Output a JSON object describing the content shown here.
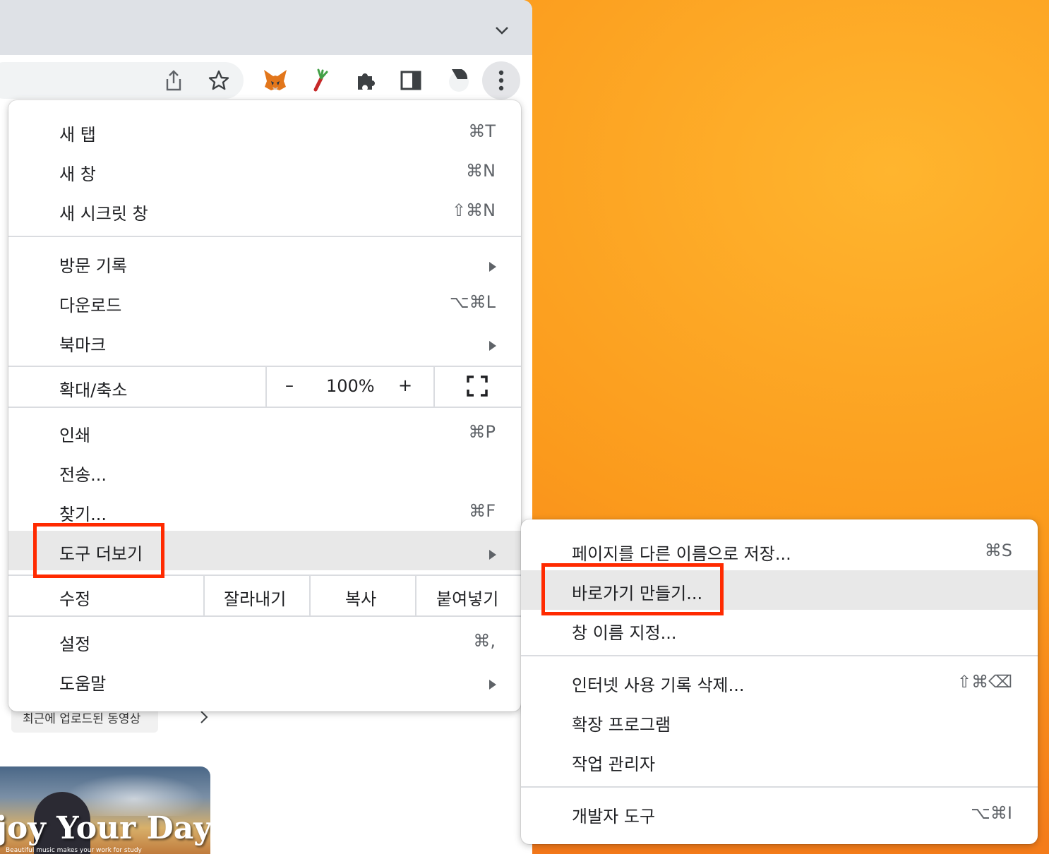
{
  "main_menu": {
    "items": [
      {
        "label": "새 탭",
        "shortcut": "⌘T"
      },
      {
        "label": "새 창",
        "shortcut": "⌘N"
      },
      {
        "label": "새 시크릿 창",
        "shortcut": "⇧⌘N"
      },
      {
        "label": "방문 기록",
        "shortcut": ""
      },
      {
        "label": "다운로드",
        "shortcut": "⌥⌘L"
      },
      {
        "label": "북마크",
        "shortcut": ""
      },
      {
        "label": "인쇄",
        "shortcut": "⌘P"
      },
      {
        "label": "전송...",
        "shortcut": ""
      },
      {
        "label": "찾기...",
        "shortcut": "⌘F"
      },
      {
        "label": "도구 더보기",
        "shortcut": ""
      },
      {
        "label": "설정",
        "shortcut": "⌘,"
      },
      {
        "label": "도움말",
        "shortcut": ""
      }
    ],
    "zoom": {
      "label": "확대/축소",
      "minus": "–",
      "value": "100%",
      "plus": "+"
    },
    "edit": {
      "label": "수정",
      "cut": "잘라내기",
      "copy": "복사",
      "paste": "붙여넣기"
    }
  },
  "sub_menu": {
    "items": [
      {
        "label": "페이지를 다른 이름으로 저장...",
        "shortcut": "⌘S"
      },
      {
        "label": "바로가기 만들기...",
        "shortcut": ""
      },
      {
        "label": "창 이름 지정...",
        "shortcut": ""
      },
      {
        "label": "인터넷 사용 기록 삭제...",
        "shortcut": "⇧⌘⌫"
      },
      {
        "label": "확장 프로그램",
        "shortcut": ""
      },
      {
        "label": "작업 관리자",
        "shortcut": ""
      },
      {
        "label": "개발자 도구",
        "shortcut": "⌥⌘I"
      }
    ]
  },
  "page": {
    "recent_button": "최근에 업로드된 동영상",
    "thumbnail_title": "joy Your Day",
    "thumbnail_subtitle": "Beautiful music makes your work for study"
  },
  "toolbar": {
    "icons": [
      "share-icon",
      "bookmark-star-icon",
      "metamask-fox-icon",
      "extension-leek-icon",
      "extensions-puzzle-icon",
      "side-panel-icon",
      "profile-avatar-icon",
      "more-menu-icon"
    ]
  },
  "colors": {
    "highlight_box": "#ff2a00",
    "menu_hover": "#e8e8e8",
    "tabstrip": "#dee1e6"
  }
}
